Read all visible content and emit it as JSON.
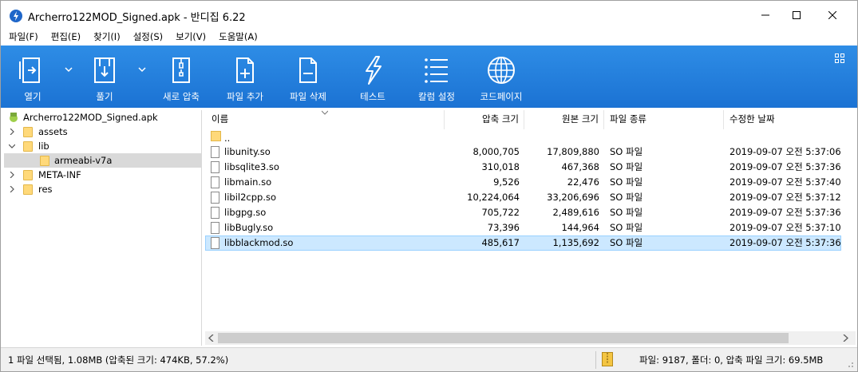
{
  "window": {
    "title": "Archerro122MOD_Signed.apk - 반디집 6.22",
    "minimize_icon": "minimize-icon",
    "maximize_icon": "maximize-icon",
    "close_icon": "close-icon"
  },
  "menu": [
    {
      "label": "파일(F)"
    },
    {
      "label": "편집(E)"
    },
    {
      "label": "찾기(I)"
    },
    {
      "label": "설정(S)"
    },
    {
      "label": "보기(V)"
    },
    {
      "label": "도움말(A)"
    }
  ],
  "toolbar": {
    "items": [
      {
        "label": "열기",
        "icon": "open-icon"
      },
      {
        "label": "풀기",
        "icon": "extract-icon"
      },
      {
        "label": "새로 압축",
        "icon": "new-archive-icon"
      },
      {
        "label": "파일 추가",
        "icon": "add-file-icon"
      },
      {
        "label": "파일 삭제",
        "icon": "delete-file-icon"
      },
      {
        "label": "테스트",
        "icon": "test-icon"
      },
      {
        "label": "칼럼 설정",
        "icon": "column-settings-icon"
      },
      {
        "label": "코드페이지",
        "icon": "codepage-icon"
      }
    ],
    "background": "#2383de"
  },
  "tree": {
    "root": "Archerro122MOD_Signed.apk",
    "items": [
      {
        "label": "assets",
        "level": 1,
        "expander": "chevron-right"
      },
      {
        "label": "lib",
        "level": 1,
        "expander": "chevron-down"
      },
      {
        "label": "armeabi-v7a",
        "level": 2,
        "expander": "",
        "selected": true
      },
      {
        "label": "META-INF",
        "level": 1,
        "expander": "chevron-right"
      },
      {
        "label": "res",
        "level": 1,
        "expander": "chevron-right"
      }
    ]
  },
  "list": {
    "columns": {
      "name": "이름",
      "compressed": "압축 크기",
      "original": "원본 크기",
      "type": "파일 종류",
      "modified": "수정한 날짜"
    },
    "parent_entry": "..",
    "rows": [
      {
        "name": "libunity.so",
        "compressed": "8,000,705",
        "original": "17,809,880",
        "type": "SO 파일",
        "modified": "2019-09-07 오전 5:37:06"
      },
      {
        "name": "libsqlite3.so",
        "compressed": "310,018",
        "original": "467,368",
        "type": "SO 파일",
        "modified": "2019-09-07 오전 5:37:36"
      },
      {
        "name": "libmain.so",
        "compressed": "9,526",
        "original": "22,476",
        "type": "SO 파일",
        "modified": "2019-09-07 오전 5:37:40"
      },
      {
        "name": "libil2cpp.so",
        "compressed": "10,224,064",
        "original": "33,206,696",
        "type": "SO 파일",
        "modified": "2019-09-07 오전 5:37:12"
      },
      {
        "name": "libgpg.so",
        "compressed": "705,722",
        "original": "2,489,616",
        "type": "SO 파일",
        "modified": "2019-09-07 오전 5:37:36"
      },
      {
        "name": "libBugly.so",
        "compressed": "73,396",
        "original": "144,964",
        "type": "SO 파일",
        "modified": "2019-09-07 오전 5:37:10"
      },
      {
        "name": "libblackmod.so",
        "compressed": "485,617",
        "original": "1,135,692",
        "type": "SO 파일",
        "modified": "2019-09-07 오전 5:37:36",
        "selected": true
      }
    ]
  },
  "status": {
    "left": "1 파일 선택됨, 1.08MB (압축된 크기: 474KB, 57.2%)",
    "right": "파일: 9187, 폴더: 0, 압축 파일 크기: 69.5MB"
  }
}
